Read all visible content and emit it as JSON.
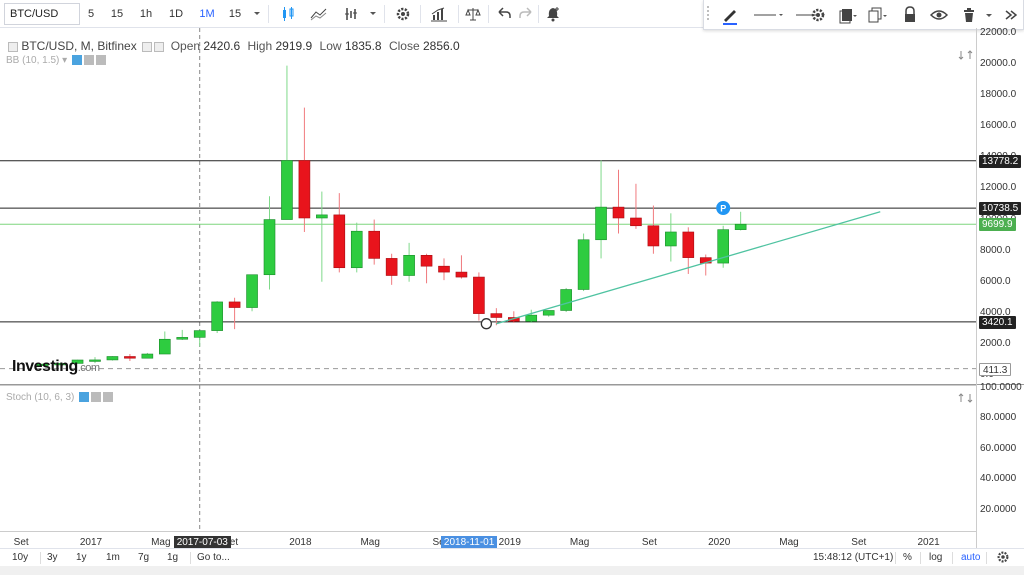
{
  "toolbar": {
    "symbol": "BTC/USD",
    "intervals": [
      "5",
      "15",
      "1h",
      "1D",
      "1M",
      "15"
    ],
    "active_interval": "1M"
  },
  "legend": {
    "title": "BTC/USD, M, Bitfinex",
    "open_label": "Open",
    "open": "2420.6",
    "high_label": "High",
    "high": "2919.9",
    "low_label": "Low",
    "low": "1835.8",
    "close_label": "Close",
    "close": "2856.0"
  },
  "indicators": {
    "bb": "BB (10, 1.5)",
    "stoch": "Stoch (10, 6, 3)"
  },
  "logo": {
    "text": "Investing",
    "suffix": ".com"
  },
  "price_axis": {
    "labels": [
      "22000.0",
      "20000.0",
      "18000.0",
      "16000.0",
      "14000.0",
      "12000.0",
      "10000.0",
      "8000.0",
      "6000.0",
      "4000.0",
      "2000.0",
      "0.0"
    ],
    "tags": [
      {
        "value": "13778.2",
        "color": "#222222"
      },
      {
        "value": "10738.5",
        "color": "#222222"
      },
      {
        "value": "9699.9",
        "color": "#4caf50"
      },
      {
        "value": "3420.1",
        "color": "#222222"
      },
      {
        "value": "411.3",
        "color": "#444444"
      }
    ]
  },
  "stoch_axis": {
    "labels": [
      "100.0000",
      "80.0000",
      "60.0000",
      "40.0000",
      "20.0000"
    ]
  },
  "time_axis": {
    "labels": [
      "Set",
      "2017",
      "Mag",
      "Set",
      "2018",
      "Mag",
      "Set",
      "2019",
      "Mag",
      "Set",
      "2020",
      "Mag",
      "Set",
      "2021"
    ],
    "crosshair_tag": "2017-07-03",
    "highlight_tag": "2018-11-01"
  },
  "bottombar": {
    "ranges": [
      "10y",
      "3y",
      "1y",
      "1m",
      "7g",
      "1g"
    ],
    "goto": "Go to...",
    "clock": "15:48:12 (UTC+1)",
    "percent": "%",
    "log": "log",
    "auto": "auto"
  },
  "marker": {
    "label": "P"
  },
  "chart_data": {
    "type": "candlestick",
    "title": "BTC/USD, M, Bitfinex",
    "xlabel": "",
    "ylabel": "",
    "ylim": [
      0,
      22000
    ],
    "x_range": [
      "2016-09",
      "2021-03"
    ],
    "candles": [
      {
        "t": "2016-10",
        "o": 610,
        "h": 720,
        "l": 600,
        "c": 700
      },
      {
        "t": "2016-11",
        "o": 700,
        "h": 760,
        "l": 690,
        "c": 745
      },
      {
        "t": "2016-12",
        "o": 745,
        "h": 980,
        "l": 740,
        "c": 965
      },
      {
        "t": "2017-01",
        "o": 965,
        "h": 1150,
        "l": 760,
        "c": 970
      },
      {
        "t": "2017-02",
        "o": 970,
        "h": 1210,
        "l": 930,
        "c": 1190
      },
      {
        "t": "2017-03",
        "o": 1190,
        "h": 1350,
        "l": 900,
        "c": 1080
      },
      {
        "t": "2017-04",
        "o": 1080,
        "h": 1420,
        "l": 1070,
        "c": 1350
      },
      {
        "t": "2017-05",
        "o": 1350,
        "h": 2800,
        "l": 1350,
        "c": 2300
      },
      {
        "t": "2017-06",
        "o": 2300,
        "h": 2900,
        "l": 2250,
        "c": 2420
      },
      {
        "t": "2017-07",
        "o": 2420.6,
        "h": 2919.9,
        "l": 1835.8,
        "c": 2856.0
      },
      {
        "t": "2017-08",
        "o": 2856,
        "h": 4750,
        "l": 2700,
        "c": 4700
      },
      {
        "t": "2017-09",
        "o": 4700,
        "h": 4970,
        "l": 2950,
        "c": 4340
      },
      {
        "t": "2017-10",
        "o": 4340,
        "h": 6450,
        "l": 4100,
        "c": 6450
      },
      {
        "t": "2017-11",
        "o": 6450,
        "h": 11500,
        "l": 5500,
        "c": 10000
      },
      {
        "t": "2017-12",
        "o": 10000,
        "h": 19900,
        "l": 10000,
        "c": 13800
      },
      {
        "t": "2018-01",
        "o": 13800,
        "h": 17200,
        "l": 9200,
        "c": 10100
      },
      {
        "t": "2018-02",
        "o": 10100,
        "h": 11800,
        "l": 6000,
        "c": 10300
      },
      {
        "t": "2018-03",
        "o": 10300,
        "h": 11700,
        "l": 6600,
        "c": 6900
      },
      {
        "t": "2018-04",
        "o": 6900,
        "h": 9800,
        "l": 6600,
        "c": 9250
      },
      {
        "t": "2018-05",
        "o": 9250,
        "h": 10000,
        "l": 7100,
        "c": 7500
      },
      {
        "t": "2018-06",
        "o": 7500,
        "h": 7800,
        "l": 5800,
        "c": 6400
      },
      {
        "t": "2018-07",
        "o": 6400,
        "h": 8500,
        "l": 6000,
        "c": 7700
      },
      {
        "t": "2018-08",
        "o": 7700,
        "h": 7800,
        "l": 5900,
        "c": 7000
      },
      {
        "t": "2018-09",
        "o": 7000,
        "h": 7500,
        "l": 6100,
        "c": 6620
      },
      {
        "t": "2018-10",
        "o": 6620,
        "h": 7700,
        "l": 6200,
        "c": 6300
      },
      {
        "t": "2018-11",
        "o": 6300,
        "h": 6600,
        "l": 3500,
        "c": 3950
      },
      {
        "t": "2018-12",
        "o": 3950,
        "h": 4300,
        "l": 3200,
        "c": 3700
      },
      {
        "t": "2019-01",
        "o": 3700,
        "h": 4100,
        "l": 3350,
        "c": 3450
      },
      {
        "t": "2019-02",
        "o": 3450,
        "h": 4200,
        "l": 3350,
        "c": 3850
      },
      {
        "t": "2019-03",
        "o": 3850,
        "h": 4150,
        "l": 3750,
        "c": 4150
      },
      {
        "t": "2019-04",
        "o": 4150,
        "h": 5600,
        "l": 4050,
        "c": 5500
      },
      {
        "t": "2019-05",
        "o": 5500,
        "h": 9100,
        "l": 5400,
        "c": 8700
      },
      {
        "t": "2019-06",
        "o": 8700,
        "h": 13800,
        "l": 7500,
        "c": 10800
      },
      {
        "t": "2019-07",
        "o": 10800,
        "h": 13200,
        "l": 9100,
        "c": 10100
      },
      {
        "t": "2019-08",
        "o": 10100,
        "h": 12300,
        "l": 9400,
        "c": 9600
      },
      {
        "t": "2019-09",
        "o": 9600,
        "h": 10900,
        "l": 7800,
        "c": 8300
      },
      {
        "t": "2019-10",
        "o": 8300,
        "h": 10400,
        "l": 7300,
        "c": 9200
      },
      {
        "t": "2019-11",
        "o": 9200,
        "h": 9500,
        "l": 6500,
        "c": 7550
      },
      {
        "t": "2019-12",
        "o": 7550,
        "h": 7750,
        "l": 6400,
        "c": 7200
      },
      {
        "t": "2020-01",
        "o": 7200,
        "h": 9600,
        "l": 6900,
        "c": 9350
      },
      {
        "t": "2020-02",
        "o": 9350,
        "h": 10500,
        "l": 9300,
        "c": 9700
      }
    ],
    "horizontal_lines": [
      13778.2,
      10738.5,
      3420.1
    ],
    "last_price_line": 9699.9,
    "dashed_line": 411.3,
    "trendline": {
      "from": {
        "t": "2018-12",
        "y": 3300
      },
      "to": {
        "t": "2020-10",
        "y": 10500
      }
    }
  }
}
